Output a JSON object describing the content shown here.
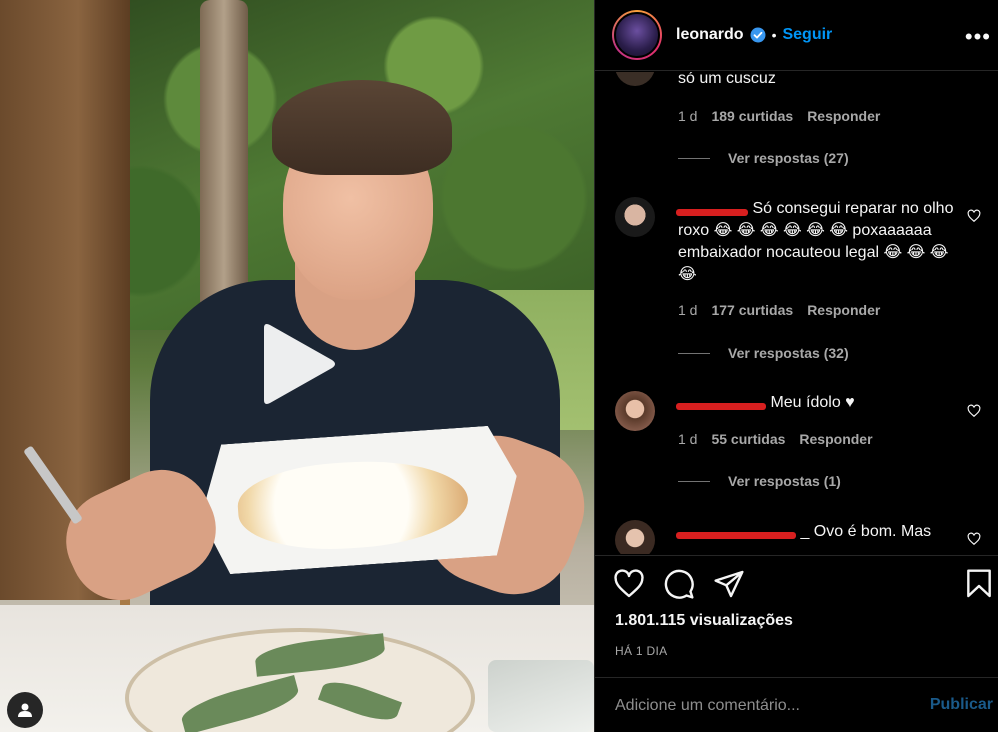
{
  "post": {
    "username": "leonardo",
    "follow_label": "Seguir",
    "dot": "•",
    "more_label": "•••"
  },
  "comments": [
    {
      "text": "só um cuscuz",
      "time": "1 d",
      "likes": "189 curtidas",
      "reply_label": "Responder",
      "view_replies": "Ver respostas (27)"
    },
    {
      "text": "Só consegui reparar no olho roxo 😂 😂 😂 😂 😂 😂 poxaaaaaa embaixador nocauteou legal 😂 😂 😂 😂",
      "time": "1 d",
      "likes": "177 curtidas",
      "reply_label": "Responder",
      "view_replies": "Ver respostas (32)"
    },
    {
      "text": "Meu ídolo ♥",
      "time": "1 d",
      "likes": "55 curtidas",
      "reply_label": "Responder",
      "view_replies": "Ver respostas (1)"
    },
    {
      "text": "_ Ovo é bom. Mas"
    }
  ],
  "stats": {
    "views": "1.801.115 visualizações",
    "time_ago": "HÁ 1 DIA"
  },
  "composer": {
    "placeholder": "Adicione um comentário...",
    "publish_label": "Publicar"
  },
  "colors": {
    "accent": "#0095f6",
    "redaction": "#d71f1f"
  },
  "icons": [
    "play-icon",
    "user-tag-icon",
    "verified-badge-icon",
    "more-options-icon",
    "heart-icon",
    "comment-icon",
    "share-icon",
    "bookmark-icon"
  ]
}
